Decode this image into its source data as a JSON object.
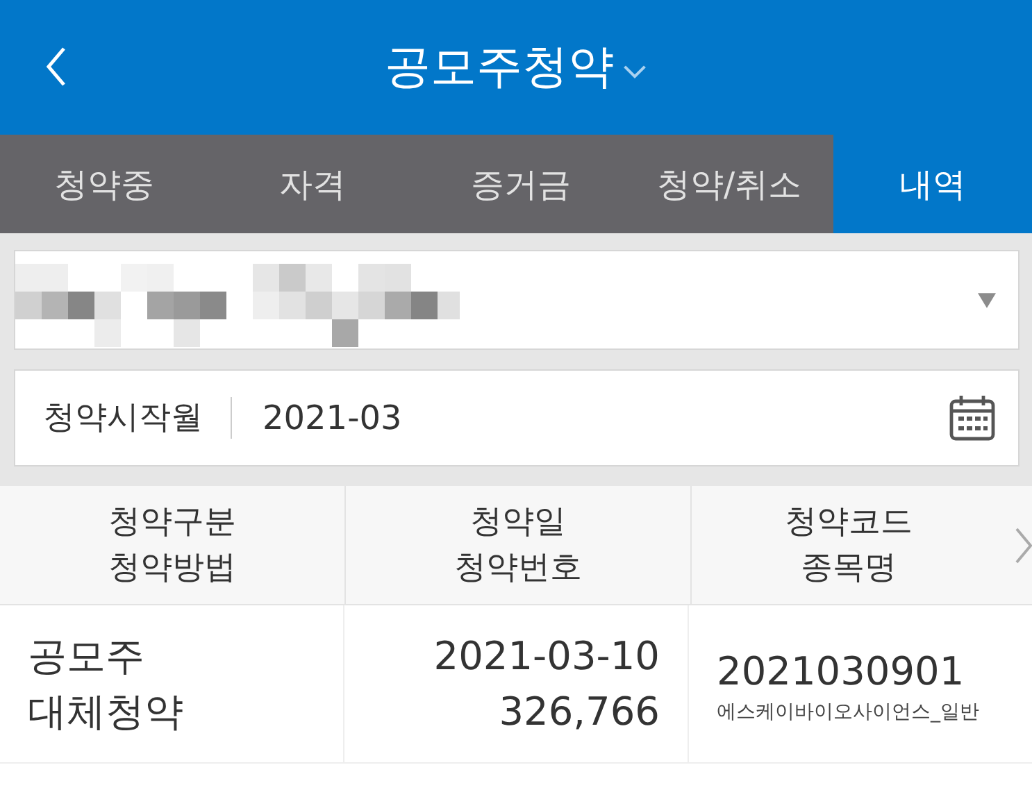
{
  "header": {
    "title": "공모주청약"
  },
  "tabs": [
    {
      "label": "청약중",
      "selected": false
    },
    {
      "label": "자격",
      "selected": false
    },
    {
      "label": "증거금",
      "selected": false
    },
    {
      "label": "청약/취소",
      "selected": false
    },
    {
      "label": "내역",
      "selected": true
    }
  ],
  "date_field": {
    "label": "청약시작월",
    "value": "2021-03"
  },
  "table": {
    "columns": [
      {
        "lines": [
          "청약구분",
          "청약방법"
        ]
      },
      {
        "lines": [
          "청약일",
          "청약번호"
        ]
      },
      {
        "lines": [
          "청약코드",
          "종목명"
        ]
      }
    ],
    "rows": [
      {
        "type": {
          "main": "공모주",
          "sub": "대체청약"
        },
        "date": "2021-03-10",
        "number": "326,766",
        "code": "2021030901",
        "name": "에스케이바이오사이언스_일반"
      }
    ]
  }
}
